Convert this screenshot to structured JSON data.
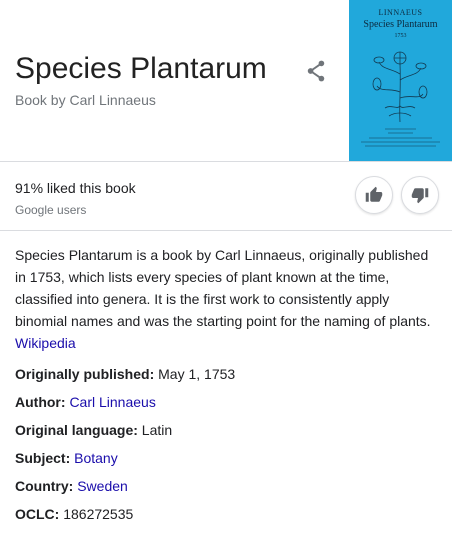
{
  "title": "Species Plantarum",
  "subtitle": "Book by Carl Linnaeus",
  "share_icon": "share-icon",
  "cover": {
    "background": "#21a8db",
    "line1": "LINNAEUS",
    "line2": "Species Plantarum",
    "line3": "1753"
  },
  "rating": {
    "liked_text": "91% liked this book",
    "source": "Google users",
    "like_icon": "thumbs-up-icon",
    "dislike_icon": "thumbs-down-icon"
  },
  "description": {
    "text": "Species Plantarum is a book by Carl Linnaeus, originally published in 1753, which lists every species of plant known at the time, classified into genera. It is the first work to consistently apply binomial names and was the starting point for the naming of plants.",
    "source_link": "Wikipedia"
  },
  "facts": [
    {
      "label": "Originally published:",
      "value": "May 1, 1753"
    },
    {
      "label": "Author:",
      "value": "Carl Linnaeus"
    },
    {
      "label": "Original language:",
      "value": "Latin"
    },
    {
      "label": "Subject:",
      "value": "Botany"
    },
    {
      "label": "Country:",
      "value": "Sweden"
    },
    {
      "label": "OCLC:",
      "value": "186272535"
    }
  ],
  "colors": {
    "link": "#1a0dab",
    "secondary_text": "#70757a"
  }
}
